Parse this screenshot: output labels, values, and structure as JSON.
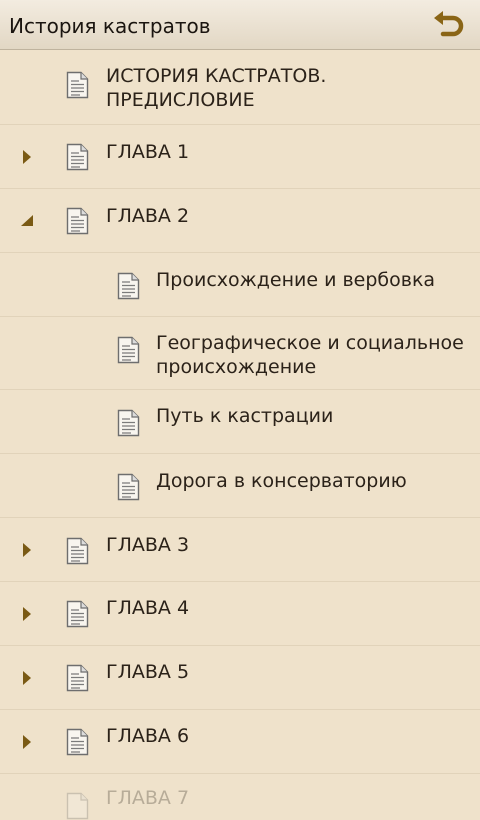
{
  "header": {
    "title": "История кастратов"
  },
  "items": [
    {
      "label": "ИСТОРИЯ КАСТРАТОВ. ПРЕДИСЛОВИЕ"
    },
    {
      "label": "ГЛАВА 1"
    },
    {
      "label": "ГЛАВА 2"
    },
    {
      "label": "Происхождение и вербовка"
    },
    {
      "label": "Географическое и социальное происхождение"
    },
    {
      "label": "Путь к кастрации"
    },
    {
      "label": "Дорога в консерваторию"
    },
    {
      "label": "ГЛАВА 3"
    },
    {
      "label": "ГЛАВА 4"
    },
    {
      "label": "ГЛАВА 5"
    },
    {
      "label": "ГЛАВА 6"
    },
    {
      "label": "ГЛАВА 7"
    }
  ],
  "colors": {
    "background": "#efe2cb",
    "arrow": "#7a5a14",
    "back_icon": "#8a6516"
  }
}
